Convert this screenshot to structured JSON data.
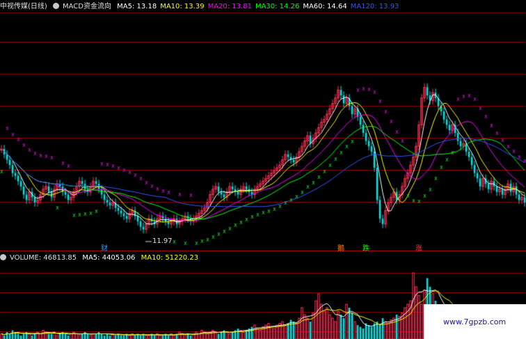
{
  "price_header": {
    "stock_name": "中视传媒(日线)",
    "indicator": "MACD资金流向",
    "ma_items": [
      {
        "label": "MA5: 13.18",
        "color": "#ffffff"
      },
      {
        "label": "MA10: 13.39",
        "color": "#ffff00"
      },
      {
        "label": "MA20: 13.81",
        "color": "#ff00ff"
      },
      {
        "label": "MA30: 14.26",
        "color": "#00ff00"
      },
      {
        "label": "MA60: 14.64",
        "color": "#ffffff"
      },
      {
        "label": "MA120: 13.93",
        "color": "#3355ff"
      }
    ]
  },
  "volume_header": {
    "title": "VOLUME: 46813.85",
    "ma5": "MA5: 44053.06",
    "ma10": "MA10: 51220.23"
  },
  "annotations": {
    "low_price": "11.97"
  },
  "signals": [
    {
      "label": "财",
      "color": "#3399ff",
      "bar": 37
    },
    {
      "label": "鹅",
      "color": "#ff8000",
      "bar": 122
    },
    {
      "label": "跌",
      "color": "#00ff00",
      "bar": 131
    },
    {
      "label": "涨",
      "color": "#ff3333",
      "bar": 150
    }
  ],
  "watermark": "www.7gpzb.com",
  "colors": {
    "up": "#ff3355",
    "down": "#00e5e5",
    "grid": "#cc0000",
    "ma5": "#ffffff",
    "ma10": "#ffff00",
    "ma20": "#ff00ff",
    "ma30": "#00ff00",
    "ma60": "#ffffff",
    "ma120": "#3355ff",
    "macd_up": "#ff00ff",
    "macd_down": "#00ff00"
  },
  "chart_data": {
    "type": "candlestick",
    "note_source": "estimated from pixels; no price axis labels visible",
    "y_ref": {
      "low_marked": 11.97
    },
    "closes": [
      14.9,
      14.7,
      14.5,
      14.3,
      14.0,
      13.9,
      13.7,
      13.5,
      13.2,
      13.0,
      13.3,
      13.1,
      12.9,
      13.0,
      13.2,
      13.4,
      13.5,
      13.3,
      13.1,
      13.4,
      13.6,
      13.5,
      13.3,
      13.2,
      13.0,
      13.1,
      13.3,
      13.5,
      13.7,
      13.6,
      13.4,
      13.3,
      13.5,
      13.7,
      13.6,
      13.4,
      13.2,
      13.0,
      12.9,
      12.8,
      12.9,
      12.7,
      12.6,
      12.5,
      12.4,
      12.3,
      12.5,
      12.6,
      12.4,
      12.2,
      12.0,
      11.9,
      12.1,
      12.3,
      12.2,
      12.1,
      12.3,
      12.4,
      12.3,
      12.2,
      12.1,
      12.2,
      12.3,
      12.1,
      12.2,
      12.3,
      12.4,
      12.3,
      12.2,
      12.3,
      12.4,
      12.5,
      12.6,
      12.7,
      12.9,
      13.2,
      13.4,
      13.5,
      13.3,
      13.2,
      13.1,
      13.3,
      13.5,
      13.4,
      13.3,
      13.2,
      13.4,
      13.5,
      13.4,
      13.3,
      13.2,
      13.4,
      13.5,
      13.6,
      13.7,
      13.8,
      13.9,
      14.0,
      14.1,
      14.2,
      14.3,
      14.5,
      14.7,
      14.6,
      14.5,
      14.4,
      14.6,
      14.8,
      15.0,
      15.2,
      15.4,
      15.1,
      15.3,
      15.5,
      15.7,
      15.9,
      16.0,
      16.2,
      16.4,
      16.6,
      16.8,
      17.1,
      16.9,
      16.6,
      16.8,
      16.5,
      16.2,
      16.4,
      16.1,
      15.8,
      15.5,
      15.2,
      15.0,
      14.8,
      14.2,
      13.0,
      12.3,
      12.1,
      12.6,
      12.9,
      13.1,
      13.3,
      13.0,
      13.2,
      13.5,
      13.8,
      14.0,
      14.3,
      14.6,
      15.0,
      15.8,
      16.8,
      17.2,
      16.9,
      16.7,
      17.0,
      16.8,
      16.5,
      16.3,
      16.0,
      15.8,
      15.6,
      15.8,
      15.5,
      15.2,
      15.0,
      15.1,
      14.8,
      14.6,
      14.3,
      14.0,
      13.8,
      13.5,
      13.8,
      13.6,
      13.4,
      13.7,
      13.5,
      13.3,
      13.4,
      13.2,
      13.4,
      13.6,
      13.3,
      13.5,
      13.2,
      13.0,
      13.1,
      12.9
    ],
    "volumes": [
      3,
      2,
      4,
      3,
      5,
      4,
      3,
      2,
      3,
      4,
      3,
      2,
      3,
      4,
      3,
      5,
      4,
      3,
      3,
      4,
      2,
      3,
      4,
      3,
      2,
      3,
      4,
      3,
      2,
      3,
      4,
      3,
      2,
      3,
      3,
      4,
      3,
      2,
      3,
      2,
      3,
      2,
      3,
      2,
      2,
      3,
      2,
      3,
      2,
      3,
      2,
      3,
      2,
      2,
      3,
      2,
      3,
      2,
      2,
      3,
      2,
      3,
      2,
      3,
      4,
      3,
      2,
      3,
      2,
      3,
      4,
      3,
      5,
      4,
      3,
      4,
      5,
      4,
      3,
      4,
      5,
      4,
      3,
      4,
      5,
      6,
      5,
      4,
      5,
      6,
      7,
      8,
      6,
      5,
      7,
      8,
      9,
      7,
      6,
      8,
      9,
      10,
      8,
      9,
      11,
      10,
      9,
      12,
      18,
      14,
      12,
      10,
      15,
      22,
      26,
      20,
      16,
      18,
      14,
      12,
      10,
      16,
      14,
      12,
      20,
      18,
      15,
      10,
      8,
      7,
      6,
      9,
      8,
      7,
      9,
      10,
      8,
      12,
      10,
      9,
      11,
      12,
      14,
      13,
      15,
      18,
      20,
      22,
      38,
      30,
      25,
      20,
      28,
      35,
      30,
      26,
      22,
      20,
      18,
      16,
      14,
      12,
      10,
      9,
      8,
      7,
      6,
      5,
      6,
      5,
      4,
      5,
      4,
      3,
      4,
      3,
      4,
      3,
      3,
      2,
      3,
      2,
      3,
      2,
      3,
      2,
      2,
      3,
      2
    ]
  }
}
